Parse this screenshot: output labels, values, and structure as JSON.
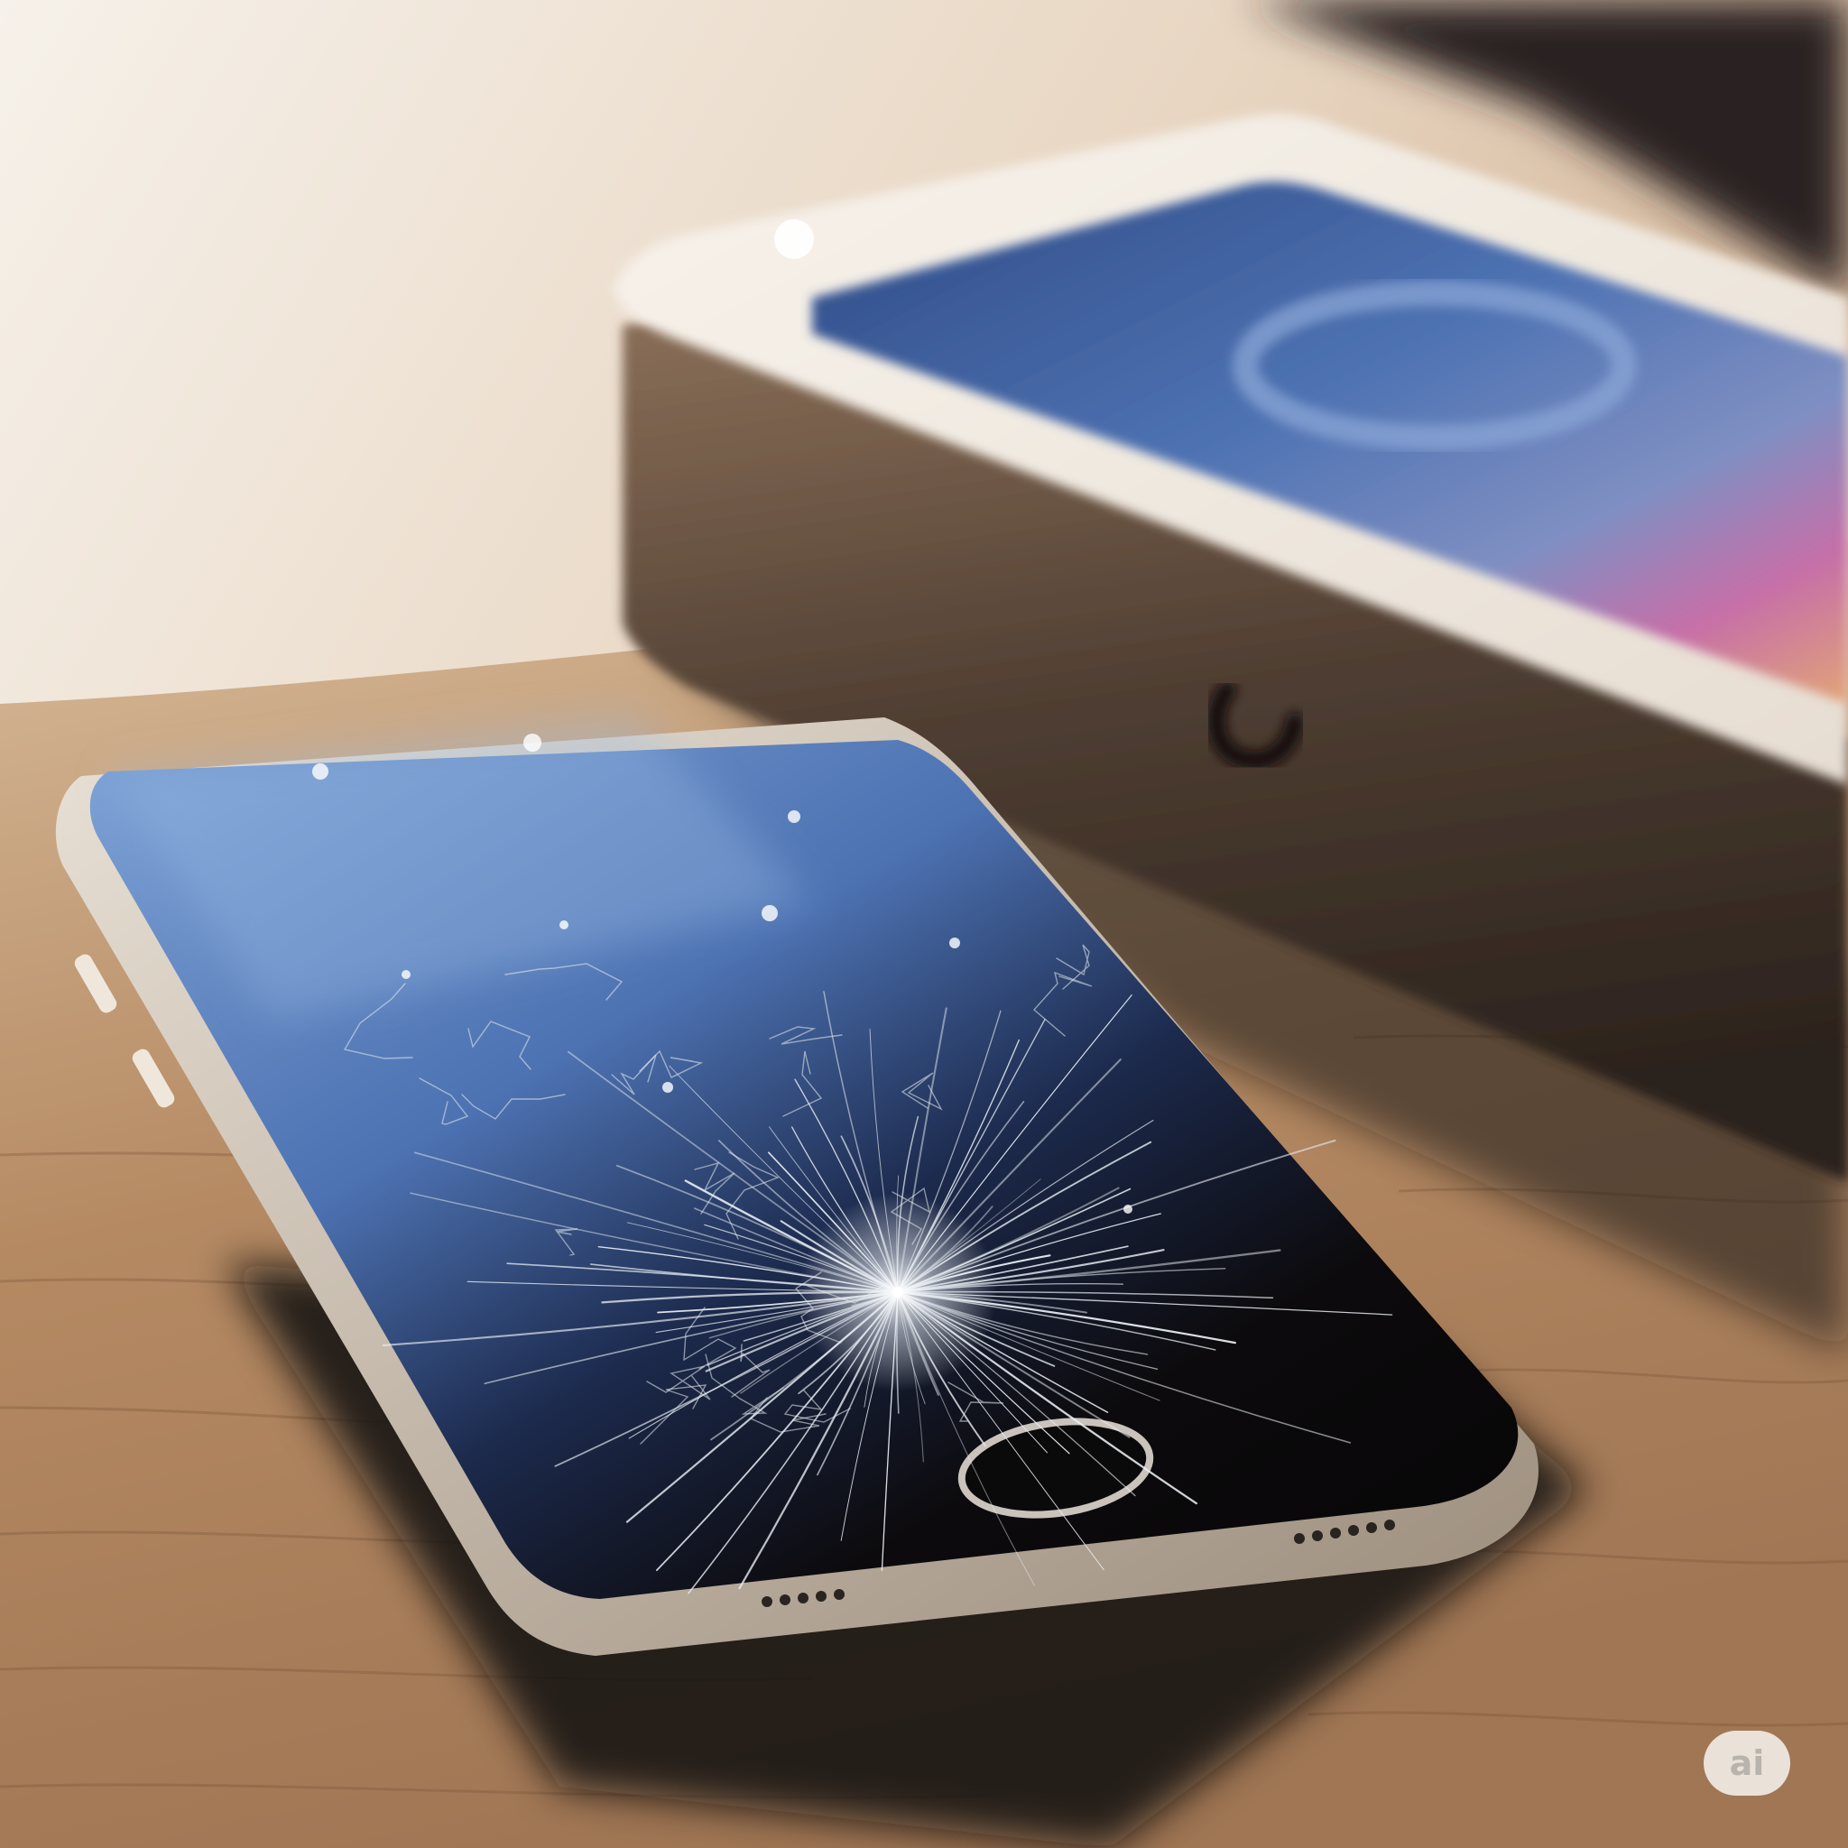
{
  "scene": {
    "subject": "cracked-smartphone",
    "secondary": "phone-box",
    "surface": "wooden-table"
  },
  "colors": {
    "wood": "#b58a63",
    "wood_dark": "#7a5638",
    "wall_light": "#f1e9e0",
    "screen_blue": "#5f86c2",
    "screen_dark": "#0c0a0c",
    "box_white": "#efe7de",
    "box_shadow_side": "#4a3b30",
    "box_art_pink": "#c66fa8",
    "box_art_orange": "#e2a477",
    "phone_frame": "#cdbfae"
  },
  "watermark": {
    "text": "ai",
    "icon": "ai-badge-icon"
  }
}
